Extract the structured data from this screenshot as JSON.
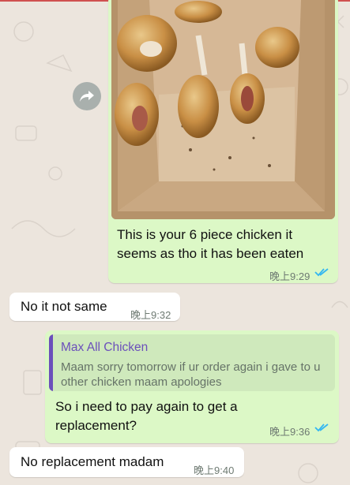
{
  "messages": [
    {
      "direction": "outgoing",
      "has_image": true,
      "image_subject": "pizza box with partly eaten chicken pieces",
      "text": "This is your 6 piece chicken  it seems as tho it has been eaten",
      "time": "晚上9:29",
      "status": "read"
    },
    {
      "direction": "incoming",
      "text": "No it not same",
      "time": "晚上9:32"
    },
    {
      "direction": "outgoing",
      "quote": {
        "author": "Max All Chicken",
        "text": "Maam sorry tomorrow if ur order again i gave to u other chicken maam apologies"
      },
      "text": "So i need to pay again to get a replacement?",
      "time": "晚上9:36",
      "status": "read"
    },
    {
      "direction": "incoming",
      "text": "No replacement madam",
      "time": "晚上9:40"
    }
  ],
  "colors": {
    "outgoing_bubble": "#dcf8c6",
    "incoming_bubble": "#ffffff",
    "read_ticks": "#34b7f1",
    "quote_author": "#6b4fbb",
    "chat_background": "#ece5dd"
  },
  "icons": {
    "forward": "forward-arrow-icon",
    "read_receipt": "double-check-icon"
  }
}
